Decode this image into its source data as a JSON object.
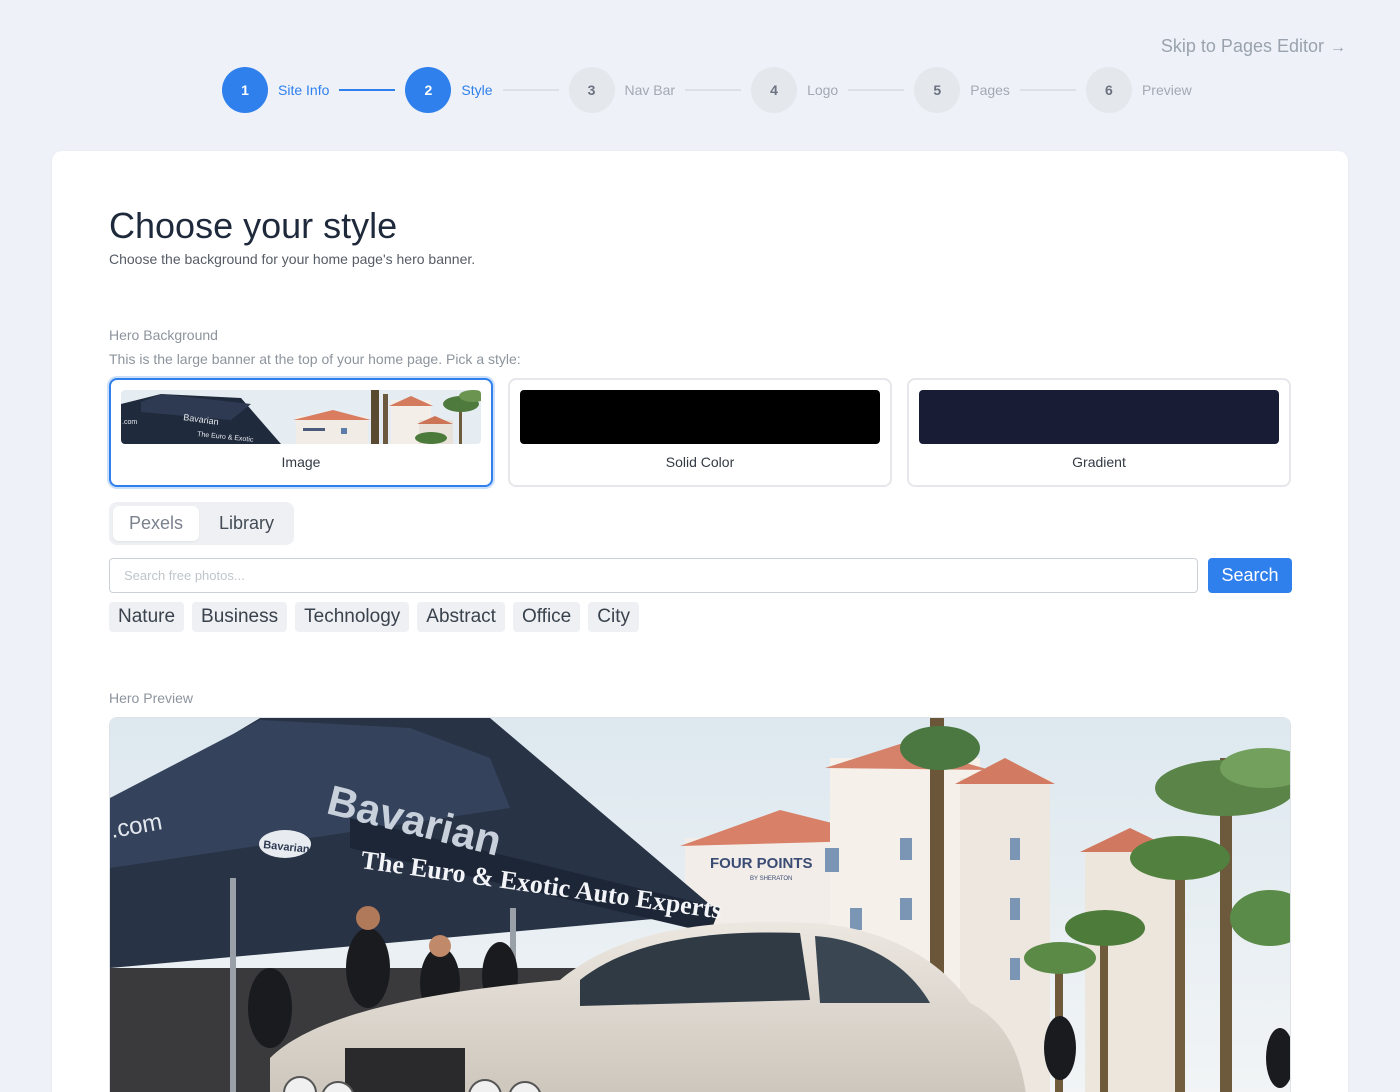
{
  "header": {
    "skip_label": "Skip to Pages Editor",
    "skip_arrow": "→"
  },
  "stepper": {
    "accent": "#2f80ed",
    "steps": [
      {
        "number": "1",
        "label": "Site Info",
        "active": true
      },
      {
        "number": "2",
        "label": "Style",
        "active": true
      },
      {
        "number": "3",
        "label": "Nav Bar",
        "active": false
      },
      {
        "number": "4",
        "label": "Logo",
        "active": false
      },
      {
        "number": "5",
        "label": "Pages",
        "active": false
      },
      {
        "number": "6",
        "label": "Preview",
        "active": false
      }
    ]
  },
  "main": {
    "title": "Choose your style",
    "subtitle": "Choose the background for your home page's hero banner.",
    "hero_background_label": "Hero Background",
    "hero_background_help": "This is the large banner at the top of your home page. Pick a style:",
    "options": [
      {
        "label": "Image",
        "selected": true
      },
      {
        "label": "Solid Color",
        "selected": false,
        "color": "#000000"
      },
      {
        "label": "Gradient",
        "selected": false,
        "color": "#181d35"
      }
    ],
    "tabs": [
      {
        "label": "Pexels",
        "active": true
      },
      {
        "label": "Library",
        "active": false
      }
    ],
    "search": {
      "placeholder": "Search free photos...",
      "button_label": "Search"
    },
    "chips": [
      "Nature",
      "Business",
      "Technology",
      "Abstract",
      "Office",
      "City"
    ],
    "hero_preview_label": "Hero Preview",
    "photo": {
      "tent_brand": "Bavarian",
      "tent_tagline": "The Euro & Exotic Auto Experts",
      "tent_side": ".com",
      "tent_badge": "Bavarian",
      "hotel_sign": "FOUR POINTS",
      "hotel_sub": "BY SHERATON"
    }
  }
}
